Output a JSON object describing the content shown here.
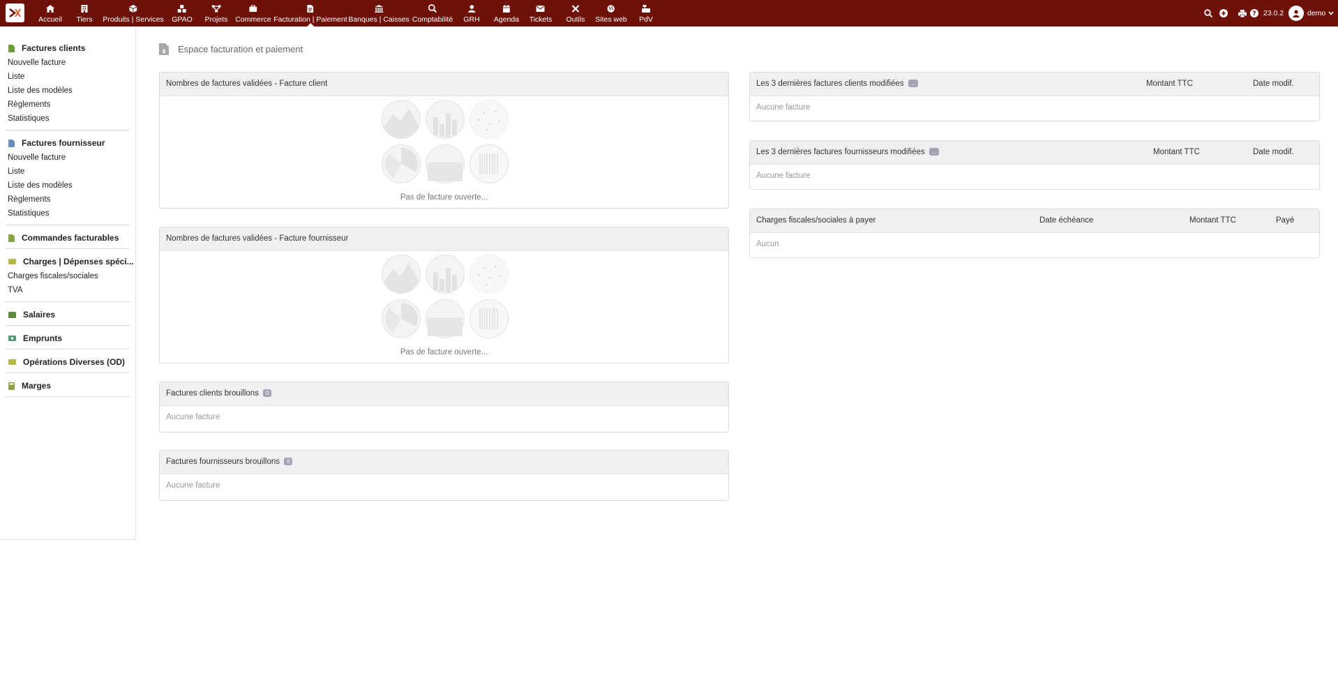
{
  "topbar": {
    "nav": [
      {
        "label": "Accueil",
        "icon": "home-icon"
      },
      {
        "label": "Tiers",
        "icon": "building-icon"
      },
      {
        "label": "Produits | Services",
        "icon": "cube-icon"
      },
      {
        "label": "GPAO",
        "icon": "cubes-icon"
      },
      {
        "label": "Projets",
        "icon": "project-icon"
      },
      {
        "label": "Commerce",
        "icon": "briefcase-icon"
      },
      {
        "label": "Facturation | Paiement",
        "icon": "invoice-icon",
        "active": true
      },
      {
        "label": "Banques | Caisses",
        "icon": "bank-icon"
      },
      {
        "label": "Comptabilité",
        "icon": "search-dollar-icon"
      },
      {
        "label": "GRH",
        "icon": "user-icon"
      },
      {
        "label": "Agenda",
        "icon": "calendar-icon"
      },
      {
        "label": "Tickets",
        "icon": "ticket-icon"
      },
      {
        "label": "Outils",
        "icon": "tools-icon"
      },
      {
        "label": "Sites web",
        "icon": "globe-icon"
      },
      {
        "label": "PdV",
        "icon": "cash-register-icon"
      }
    ],
    "version": "23.0.2",
    "user": "demo"
  },
  "sidebar": {
    "sections": [
      {
        "title": "Factures clients",
        "items": [
          "Nouvelle facture",
          "Liste",
          "Liste des modèles",
          "Règlements",
          "Statistiques"
        ]
      },
      {
        "title": "Factures fournisseur",
        "items": [
          "Nouvelle facture",
          "Liste",
          "Liste des modèles",
          "Règlements",
          "Statistiques"
        ]
      },
      {
        "title": "Commandes facturables",
        "items": []
      },
      {
        "title": "Charges | Dépenses spéci...",
        "items": [
          "Charges fiscales/sociales",
          "TVA"
        ]
      },
      {
        "title": "Salaires",
        "items": []
      },
      {
        "title": "Emprunts",
        "items": []
      },
      {
        "title": "Opérations Diverses (OD)",
        "items": []
      },
      {
        "title": "Marges",
        "items": []
      }
    ]
  },
  "page": {
    "title": "Espace facturation et paiement"
  },
  "boxes": {
    "client_stats": {
      "title": "Nombres de factures validées - Facture client",
      "empty": "Pas de facture ouverte..."
    },
    "supplier_stats": {
      "title": "Nombres de factures validées - Facture fournisseur",
      "empty": "Pas de facture ouverte..."
    },
    "client_drafts": {
      "title": "Factures clients brouillons",
      "badge": "0",
      "empty": "Aucune facture"
    },
    "supplier_drafts": {
      "title": "Factures fournisseurs brouillons",
      "badge": "0",
      "empty": "Aucune facture"
    },
    "last_client": {
      "title": "Les 3 dernières factures clients modifiées",
      "badge": "...",
      "col_amount": "Montant TTC",
      "col_date": "Date modif.",
      "empty": "Aucune facture"
    },
    "last_supplier": {
      "title": "Les 3 dernières factures fournisseurs modifiées",
      "badge": "...",
      "col_amount": "Montant TTC",
      "col_date": "Date modif.",
      "empty": "Aucune facture"
    },
    "charges": {
      "title": "Charges fiscales/sociales à payer",
      "col_due": "Date échéance",
      "col_amount": "Montant TTC",
      "col_paid": "Payé",
      "empty": "Aucun"
    }
  },
  "colors": {
    "topbar": "#6e1209",
    "box_header": "#f0f0f2",
    "badge": "#a3a3b3"
  }
}
